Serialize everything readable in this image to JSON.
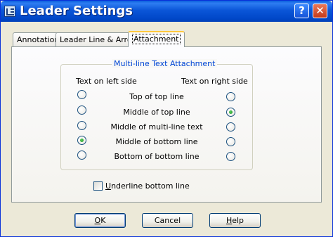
{
  "window": {
    "title": "Leader Settings"
  },
  "title_buttons": {
    "help": "?",
    "close": "✕"
  },
  "tabs": [
    {
      "label": "Annotation",
      "active": false
    },
    {
      "label": "Leader Line & Arrow",
      "active": false
    },
    {
      "label": "Attachment",
      "active": true
    }
  ],
  "attachment": {
    "group_title": "Multi-line Text Attachment",
    "left_header": "Text on left side",
    "right_header": "Text on right side",
    "rows": [
      {
        "label": "Top of top line",
        "left_selected": false,
        "right_selected": false
      },
      {
        "label": "Middle of top line",
        "left_selected": false,
        "right_selected": true
      },
      {
        "label": "Middle of multi-line text",
        "left_selected": false,
        "right_selected": false
      },
      {
        "label": "Middle of bottom line",
        "left_selected": true,
        "right_selected": false
      },
      {
        "label": "Bottom of bottom line",
        "left_selected": false,
        "right_selected": false
      }
    ],
    "underline_checkbox": {
      "label_mnemonic": "U",
      "label_rest": "nderline bottom line",
      "checked": false
    }
  },
  "buttons": {
    "ok": {
      "mnemonic": "O",
      "rest": "K"
    },
    "cancel": {
      "label": "Cancel"
    },
    "help": {
      "mnemonic": "H",
      "rest": "elp"
    }
  },
  "colors": {
    "titlebar": "#0054e3",
    "group_title": "#0046d5",
    "active_tab_highlight": "#ffc83c",
    "dialog_bg": "#ece9d8"
  },
  "icons": {
    "app": "autocad-dialog-icon",
    "help": "help-question-icon",
    "close": "close-x-icon"
  }
}
